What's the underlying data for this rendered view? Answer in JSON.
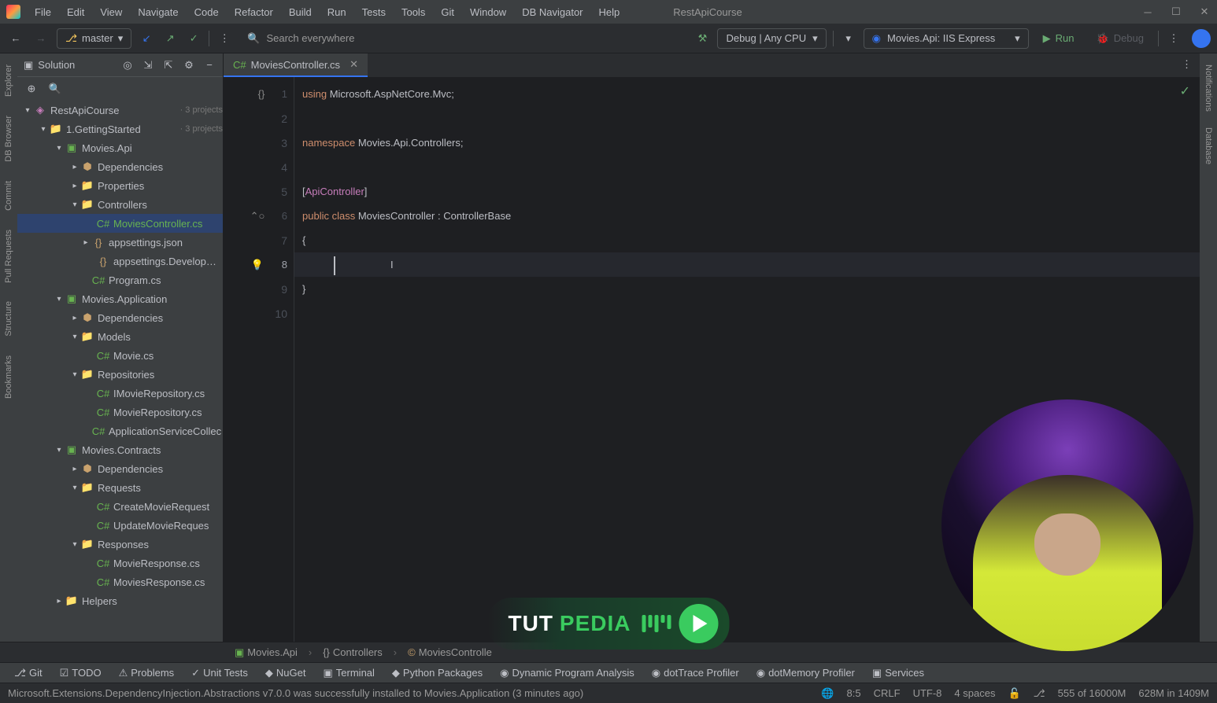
{
  "title": {
    "project": "RestApiCourse"
  },
  "menu": [
    "File",
    "Edit",
    "View",
    "Navigate",
    "Code",
    "Refactor",
    "Build",
    "Run",
    "Tests",
    "Tools",
    "Git",
    "Window",
    "DB Navigator",
    "Help"
  ],
  "toolbar": {
    "branch": "master",
    "search_placeholder": "Search everywhere",
    "build_config": "Debug | Any CPU",
    "run_config": "Movies.Api: IIS Express",
    "run_label": "Run",
    "debug_label": "Debug"
  },
  "solution": {
    "title": "Solution",
    "root": {
      "name": "RestApiCourse",
      "suffix": "· 3 projects"
    },
    "getting_started": {
      "name": "1.GettingStarted",
      "suffix": "· 3 projects"
    },
    "projects": {
      "api": "Movies.Api",
      "application": "Movies.Application",
      "contracts": "Movies.Contracts"
    },
    "folders": {
      "dependencies": "Dependencies",
      "properties": "Properties",
      "controllers": "Controllers",
      "models": "Models",
      "repositories": "Repositories",
      "requests": "Requests",
      "responses": "Responses",
      "helpers": "Helpers"
    },
    "files": {
      "movies_controller": "MoviesController.cs",
      "appsettings": "appsettings.json",
      "appsettings_dev": "appsettings.Development",
      "program": "Program.cs",
      "movie": "Movie.cs",
      "imovie_repo": "IMovieRepository.cs",
      "movie_repo": "MovieRepository.cs",
      "app_service": "ApplicationServiceCollec",
      "create_movie_req": "CreateMovieRequest",
      "update_movie_req": "UpdateMovieReques",
      "movie_response": "MovieResponse.cs",
      "movies_response": "MoviesResponse.cs"
    }
  },
  "left_strip": [
    "Explorer",
    "DB Browser",
    "Commit",
    "Pull Requests",
    "Structure",
    "Bookmarks"
  ],
  "editor": {
    "tab": {
      "label": "MoviesController.cs",
      "lang": "C#"
    },
    "lines": {
      "l1_a": "using",
      "l1_b": " Microsoft.AspNetCore.Mvc;",
      "l3_a": "namespace",
      "l3_b": " Movies.Api.Controllers;",
      "l5_a": "[",
      "l5_b": "ApiController",
      "l5_c": "]",
      "l6_a": "public",
      "l6_b": " class",
      "l6_c": " MoviesController",
      "l6_d": " : ",
      "l6_e": "ControllerBase",
      "l7": "{",
      "l9": "}"
    },
    "line_nums": [
      "1",
      "2",
      "3",
      "4",
      "5",
      "6",
      "7",
      "8",
      "9",
      "10"
    ]
  },
  "breadcrumb": [
    "Movies.Api",
    "Controllers",
    "MoviesControlle"
  ],
  "bottom_tabs": [
    "Git",
    "TODO",
    "Problems",
    "Unit Tests",
    "NuGet",
    "Terminal",
    "Python Packages",
    "Dynamic Program Analysis",
    "dotTrace Profiler",
    "dotMemory Profiler",
    "Services"
  ],
  "status": {
    "msg": "Microsoft.Extensions.DependencyInjection.Abstractions v7.0.0 was successfully installed to Movies.Application (3 minutes ago)",
    "pos": "8:5",
    "eol": "CRLF",
    "enc": "UTF-8",
    "indent": "4 spaces",
    "mem": "555 of 16000M",
    "heap": "628M in 1409M"
  },
  "watermark": {
    "t1": "TUT",
    "t2": "PEDIA"
  }
}
